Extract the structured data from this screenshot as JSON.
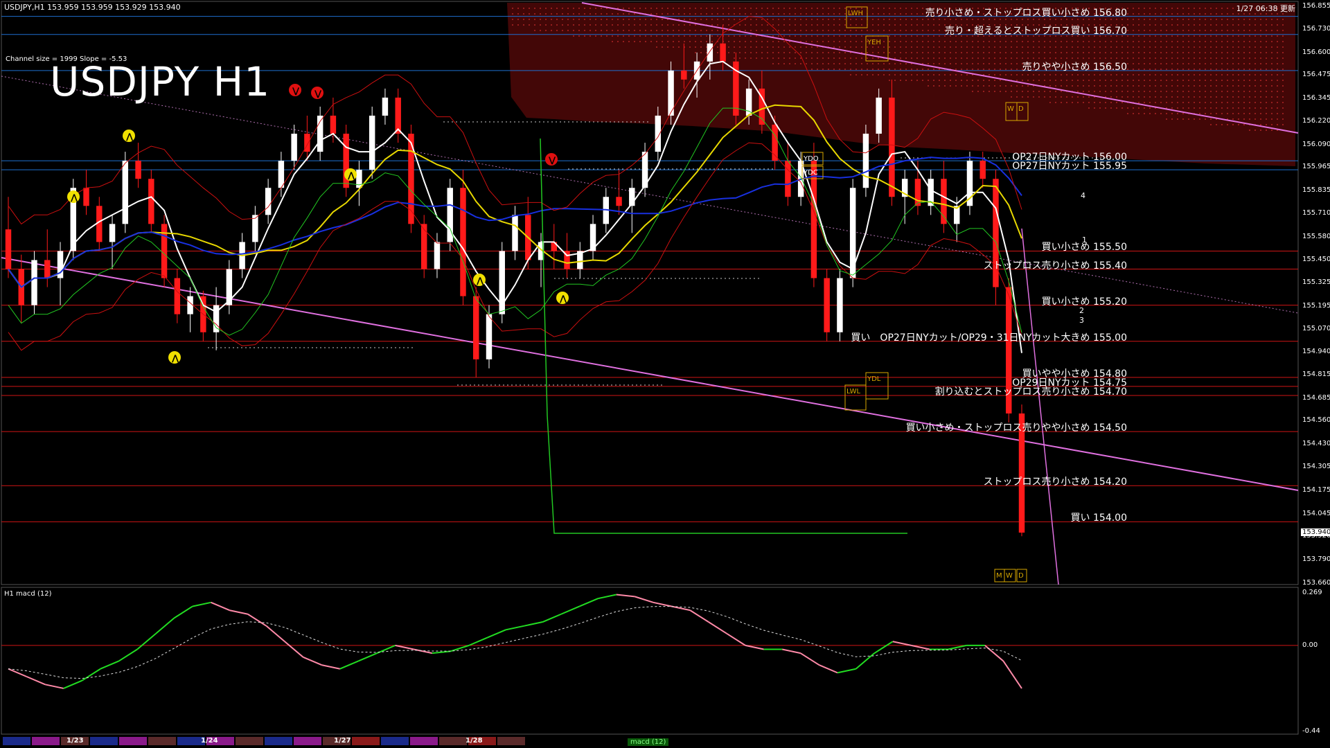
{
  "header": {
    "symbol_info": "USDJPY,H1  153.959 153.959 153.929 153.940",
    "datetime": "1/27 06:38 更新"
  },
  "chart_title": "USDJPY H1",
  "channel_info": "Channel size = 1999 Slope = -5.53",
  "macd_label": "H1  macd (12)",
  "current_price": "153.940",
  "price_axis_ticks": [
    "156.855",
    "156.730",
    "156.600",
    "156.475",
    "156.345",
    "156.220",
    "156.090",
    "155.965",
    "155.835",
    "155.710",
    "155.580",
    "155.450",
    "155.325",
    "155.195",
    "155.070",
    "154.940",
    "154.815",
    "154.685",
    "154.560",
    "154.430",
    "154.305",
    "154.175",
    "154.045",
    "153.920",
    "153.790",
    "153.660"
  ],
  "macd_axis_ticks": [
    "0.269",
    "0.00",
    "-0.44"
  ],
  "levels": [
    {
      "text": "売り小さめ・ストップロス買い小さめ 156.80",
      "price": 156.8,
      "color": "#1e6fd0"
    },
    {
      "text": "売り・超えるとストップロス買い 156.70",
      "price": 156.7,
      "color": "#1e6fd0"
    },
    {
      "text": "売りやや小さめ 156.50",
      "price": 156.5,
      "color": "#1e6fd0"
    },
    {
      "text": "OP27日NYカット 156.00",
      "price": 156.0,
      "color": "#1e6fd0"
    },
    {
      "text": "OP27日NYカット 155.95",
      "price": 155.95,
      "color": "#1e6fd0"
    },
    {
      "text": "買い小さめ 155.50",
      "price": 155.5,
      "color": "#d01515"
    },
    {
      "text": "ストップロス売り小さめ 155.40",
      "price": 155.4,
      "color": "#d01515"
    },
    {
      "text": "買い小さめ 155.20",
      "price": 155.2,
      "color": "#d01515"
    },
    {
      "text": "買い　OP27日NYカット/OP29・31日NYカット大きめ 155.00",
      "price": 155.0,
      "color": "#d01515"
    },
    {
      "text": "買いやや小さめ 154.80",
      "price": 154.8,
      "color": "#d01515"
    },
    {
      "text": "OP29日NYカット 154.75",
      "price": 154.75,
      "color": "#d01515"
    },
    {
      "text": "割り込むとストップロス売り小さめ 154.70",
      "price": 154.7,
      "color": "#d01515"
    },
    {
      "text": "買い小さめ・ストップロス売りやや小さめ 154.50",
      "price": 154.5,
      "color": "#d01515"
    },
    {
      "text": "ストップロス売り小さめ 154.20",
      "price": 154.2,
      "color": "#d01515"
    },
    {
      "text": "買い 154.00",
      "price": 154.0,
      "color": "#d01515"
    }
  ],
  "box_labels": {
    "lwh": "LWH",
    "yeh": "YEH",
    "ydo": "YDO",
    "ydc": "YDC",
    "ydl": "YDL",
    "lwl": "LWL",
    "w": "W",
    "d": "D",
    "m": "M"
  },
  "wave_labels": [
    "1",
    "2",
    "3",
    "4"
  ],
  "date_labels": [
    "1/23",
    "1/24",
    "1/27",
    "1/28"
  ],
  "macd_bottom_label": "macd (12)",
  "colors": {
    "bull": "#ffffff",
    "bear": "#ff1a1a",
    "ma_white": "#ffffff",
    "ma_yellow": "#e8d800",
    "ma_blue": "#1830e0",
    "bb": "#cc1010",
    "green": "#22c822",
    "pink": "#e070e0",
    "cloud": "#c01818",
    "macd_up": "#22dd22",
    "macd_dn": "#ff8aa8"
  },
  "chart_data": {
    "type": "candlestick",
    "title": "USDJPY H1",
    "ylim": [
      153.66,
      156.86
    ],
    "candles": [
      [
        155.62,
        155.8,
        155.35,
        155.4
      ],
      [
        155.4,
        155.48,
        155.1,
        155.2
      ],
      [
        155.2,
        155.5,
        155.15,
        155.45
      ],
      [
        155.45,
        155.62,
        155.3,
        155.35
      ],
      [
        155.35,
        155.55,
        155.2,
        155.5
      ],
      [
        155.5,
        155.9,
        155.45,
        155.85
      ],
      [
        155.85,
        155.95,
        155.7,
        155.75
      ],
      [
        155.75,
        155.8,
        155.5,
        155.55
      ],
      [
        155.55,
        155.7,
        155.4,
        155.65
      ],
      [
        155.65,
        156.05,
        155.6,
        156.0
      ],
      [
        156.0,
        156.1,
        155.85,
        155.9
      ],
      [
        155.9,
        155.95,
        155.6,
        155.65
      ],
      [
        155.65,
        155.7,
        155.3,
        155.35
      ],
      [
        155.35,
        155.4,
        155.1,
        155.15
      ],
      [
        155.15,
        155.3,
        155.05,
        155.25
      ],
      [
        155.25,
        155.28,
        155.0,
        155.05
      ],
      [
        155.05,
        155.3,
        154.95,
        155.2
      ],
      [
        155.2,
        155.45,
        155.15,
        155.4
      ],
      [
        155.4,
        155.6,
        155.35,
        155.55
      ],
      [
        155.55,
        155.75,
        155.5,
        155.7
      ],
      [
        155.7,
        155.9,
        155.65,
        155.85
      ],
      [
        155.85,
        156.05,
        155.8,
        156.0
      ],
      [
        156.0,
        156.2,
        155.95,
        156.15
      ],
      [
        156.15,
        156.25,
        156.0,
        156.05
      ],
      [
        156.05,
        156.3,
        156.0,
        156.25
      ],
      [
        156.25,
        156.35,
        156.1,
        156.15
      ],
      [
        156.15,
        156.2,
        155.8,
        155.85
      ],
      [
        155.85,
        156.0,
        155.75,
        155.95
      ],
      [
        155.95,
        156.3,
        155.9,
        156.25
      ],
      [
        156.25,
        156.4,
        156.2,
        156.35
      ],
      [
        156.35,
        156.4,
        156.1,
        156.15
      ],
      [
        156.15,
        156.2,
        155.6,
        155.65
      ],
      [
        155.65,
        155.7,
        155.35,
        155.4
      ],
      [
        155.4,
        155.6,
        155.35,
        155.55
      ],
      [
        155.55,
        155.9,
        155.5,
        155.85
      ],
      [
        155.85,
        155.95,
        155.2,
        155.25
      ],
      [
        155.25,
        155.3,
        154.8,
        154.9
      ],
      [
        154.9,
        155.2,
        154.85,
        155.15
      ],
      [
        155.15,
        155.55,
        155.1,
        155.5
      ],
      [
        155.5,
        155.75,
        155.45,
        155.7
      ],
      [
        155.7,
        155.8,
        155.4,
        155.45
      ],
      [
        155.45,
        155.6,
        155.3,
        155.55
      ],
      [
        155.55,
        155.65,
        155.4,
        155.5
      ],
      [
        155.5,
        155.6,
        155.35,
        155.4
      ],
      [
        155.4,
        155.55,
        155.35,
        155.5
      ],
      [
        155.5,
        155.7,
        155.45,
        155.65
      ],
      [
        155.65,
        155.85,
        155.6,
        155.8
      ],
      [
        155.8,
        155.95,
        155.7,
        155.75
      ],
      [
        155.75,
        155.9,
        155.6,
        155.85
      ],
      [
        155.85,
        156.1,
        155.8,
        156.05
      ],
      [
        156.05,
        156.3,
        156.0,
        156.25
      ],
      [
        156.25,
        156.55,
        156.2,
        156.5
      ],
      [
        156.5,
        156.65,
        156.4,
        156.45
      ],
      [
        156.45,
        156.6,
        156.35,
        156.55
      ],
      [
        156.55,
        156.7,
        156.45,
        156.65
      ],
      [
        156.65,
        156.75,
        156.5,
        156.55
      ],
      [
        156.55,
        156.6,
        156.2,
        156.25
      ],
      [
        156.25,
        156.45,
        156.2,
        156.4
      ],
      [
        156.4,
        156.5,
        156.15,
        156.2
      ],
      [
        156.2,
        156.25,
        155.95,
        156.0
      ],
      [
        156.0,
        156.1,
        155.75,
        155.8
      ],
      [
        155.8,
        156.05,
        155.75,
        156.0
      ],
      [
        156.0,
        156.1,
        155.3,
        155.35
      ],
      [
        155.35,
        155.4,
        155.0,
        155.05
      ],
      [
        155.05,
        155.4,
        155.0,
        155.35
      ],
      [
        155.35,
        155.9,
        155.3,
        155.85
      ],
      [
        155.85,
        156.2,
        155.8,
        156.15
      ],
      [
        156.15,
        156.4,
        156.1,
        156.35
      ],
      [
        156.35,
        156.45,
        155.75,
        155.8
      ],
      [
        155.8,
        155.95,
        155.65,
        155.9
      ],
      [
        155.9,
        156.0,
        155.7,
        155.75
      ],
      [
        155.75,
        155.95,
        155.7,
        155.9
      ],
      [
        155.9,
        156.0,
        155.6,
        155.65
      ],
      [
        155.65,
        155.8,
        155.55,
        155.75
      ],
      [
        155.75,
        156.05,
        155.7,
        156.0
      ],
      [
        156.0,
        156.05,
        155.85,
        155.9
      ],
      [
        155.9,
        155.95,
        155.2,
        155.3
      ],
      [
        155.3,
        155.35,
        154.55,
        154.6
      ],
      [
        154.6,
        154.65,
        153.92,
        153.94
      ]
    ],
    "macd": [
      -0.12,
      -0.16,
      -0.2,
      -0.22,
      -0.18,
      -0.12,
      -0.08,
      -0.02,
      0.06,
      0.14,
      0.2,
      0.22,
      0.18,
      0.16,
      0.1,
      0.02,
      -0.06,
      -0.1,
      -0.12,
      -0.08,
      -0.04,
      0.0,
      -0.02,
      -0.04,
      -0.03,
      0.0,
      0.04,
      0.08,
      0.1,
      0.12,
      0.16,
      0.2,
      0.24,
      0.26,
      0.25,
      0.22,
      0.2,
      0.18,
      0.12,
      0.06,
      0.0,
      -0.02,
      -0.02,
      -0.04,
      -0.1,
      -0.14,
      -0.12,
      -0.04,
      0.02,
      0.0,
      -0.02,
      -0.02,
      0.0,
      0.0,
      -0.08,
      -0.22
    ],
    "macd_ylim": [
      -0.44,
      0.269
    ]
  }
}
